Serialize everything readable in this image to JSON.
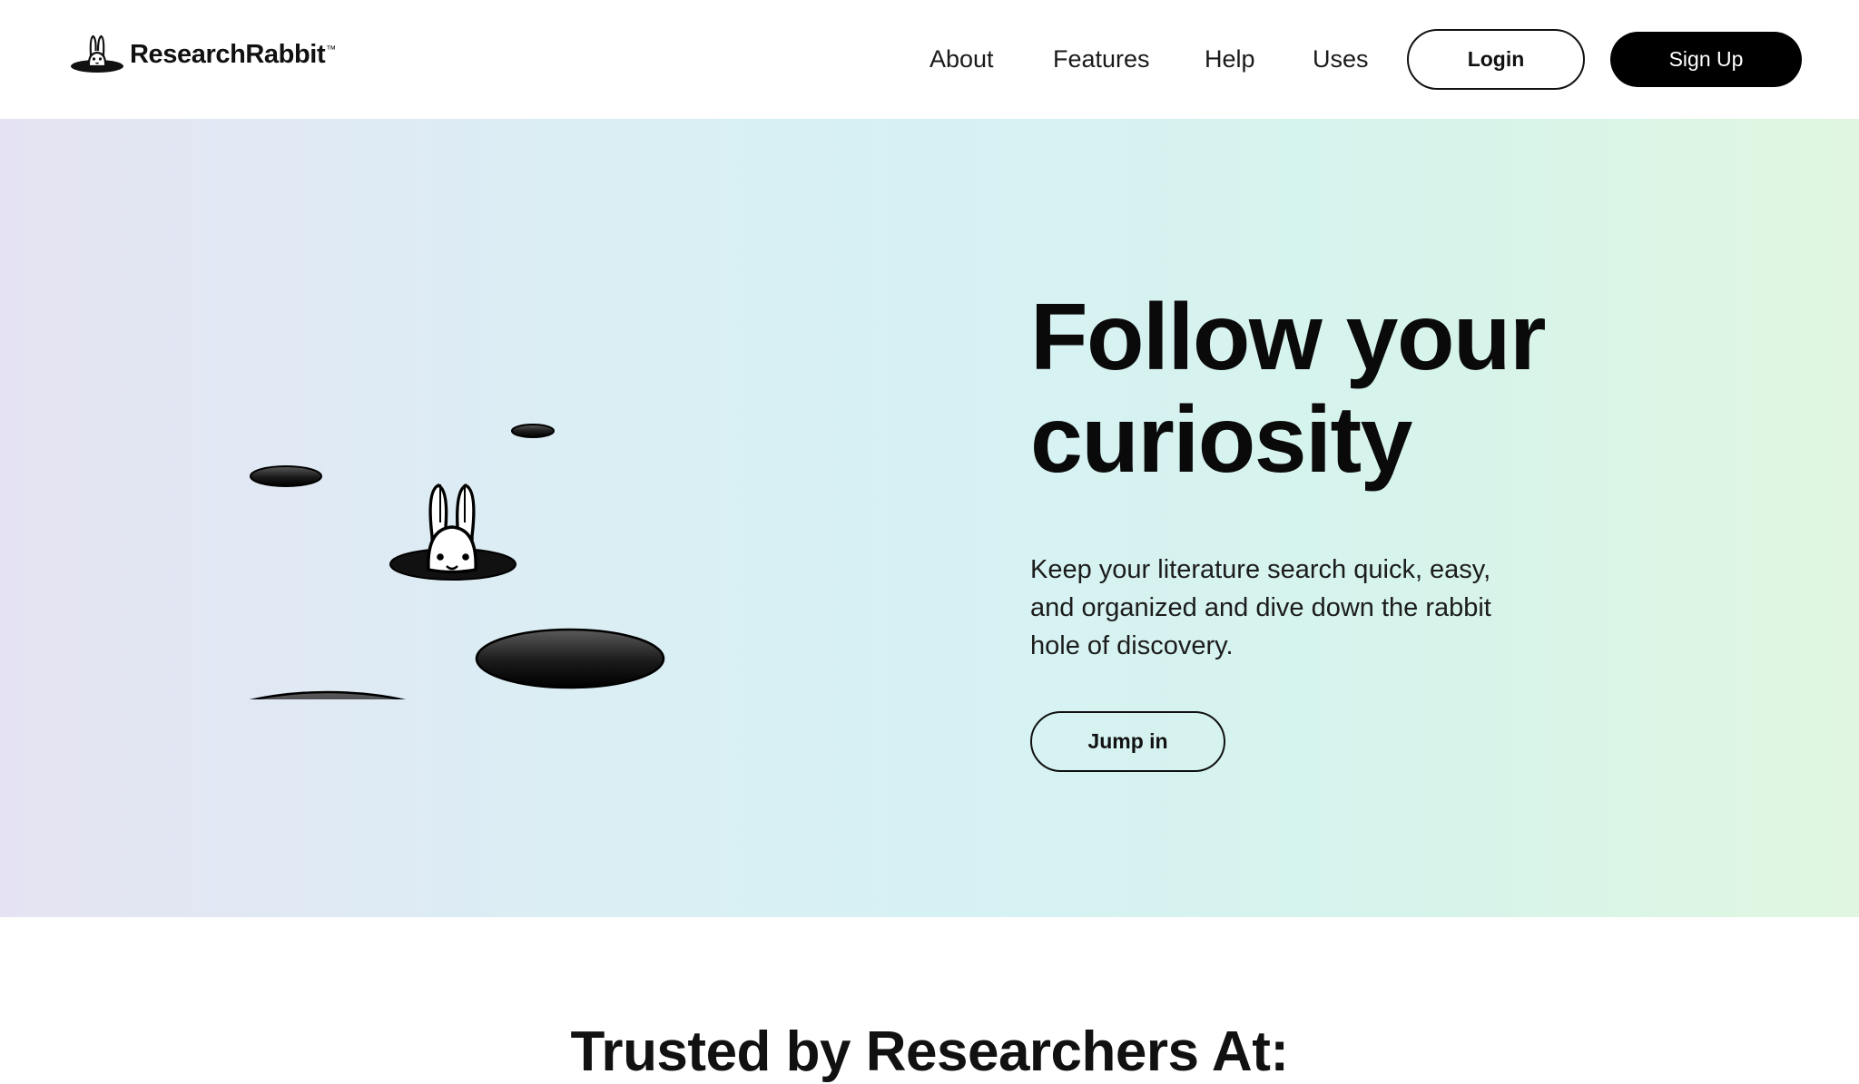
{
  "brand": {
    "name": "ResearchRabbit",
    "trademark": "™",
    "logo_icon": "rabbit-in-hole-icon"
  },
  "nav": {
    "links": [
      {
        "label": "About"
      },
      {
        "label": "Features"
      },
      {
        "label": "Help"
      },
      {
        "label": "Uses"
      }
    ],
    "login_label": "Login",
    "signup_label": "Sign Up"
  },
  "hero": {
    "title_line1": "Follow your",
    "title_line2": "curiosity",
    "subtitle": "Keep your literature search quick, easy, and organized and dive down the rabbit hole of discovery.",
    "cta_label": "Jump in",
    "illustration_icon": "rabbit-holes-illustration"
  },
  "trusted": {
    "title": "Trusted by Researchers At:"
  },
  "colors": {
    "accent": "#000000",
    "hero_gradient_start": "#e5e3f3",
    "hero_gradient_mid": "#d6f1f4",
    "hero_gradient_end": "#e0f6e0"
  }
}
